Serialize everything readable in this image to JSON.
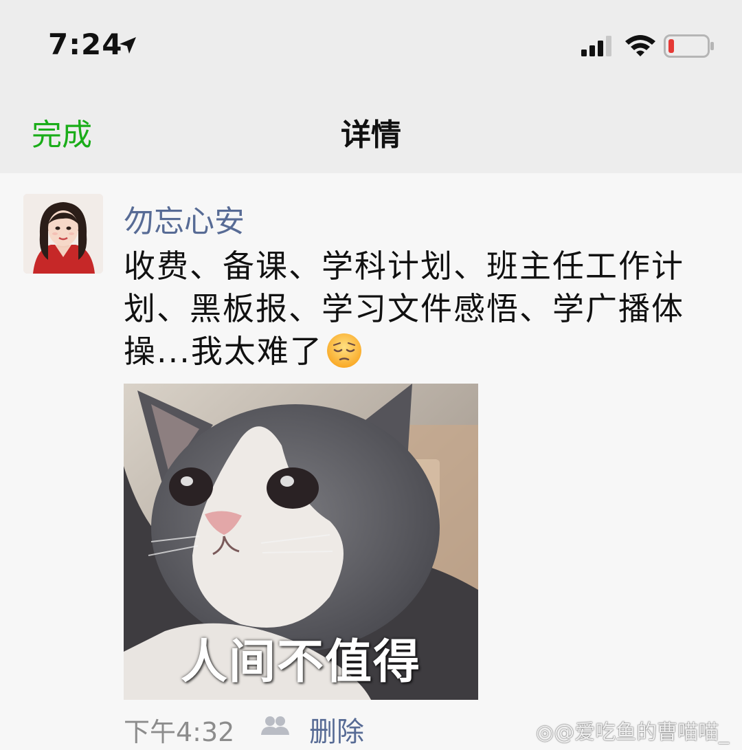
{
  "status_bar": {
    "time": "7:24",
    "battery_color": "#e53935"
  },
  "nav": {
    "done_label": "完成",
    "title": "详情"
  },
  "post": {
    "author": "勿忘心安",
    "text": "收费、备课、学科计划、班主任工作计划、黑板报、学习文件感悟、学广播体操...我太难了",
    "emoji": "pensive-face",
    "image_caption": "人间不值得",
    "time": "下午4:32",
    "delete_label": "删除"
  },
  "watermark": {
    "text": "@爱吃鱼的曹喵喵_"
  },
  "colors": {
    "accent_green": "#1aad19",
    "link_blue": "#576b95",
    "meta_gray": "#8c8c8c"
  }
}
